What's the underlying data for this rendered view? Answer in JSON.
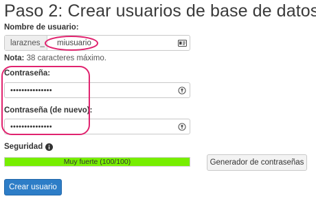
{
  "page": {
    "title": "Paso 2: Crear usuarios de base de datos:"
  },
  "username": {
    "label": "Nombre de usuario:",
    "prefix": "laraznes_",
    "value": "miusuario",
    "icon": "id-card-icon"
  },
  "note": {
    "label": "Nota:",
    "text": " 38 caracteres máximo."
  },
  "password": {
    "label": "Contraseña:",
    "value": "•••••••••••••••",
    "icon": "key-icon"
  },
  "password_confirm": {
    "label": "Contraseña (de nuevo):",
    "value": "•••••••••••••••",
    "icon": "key-icon"
  },
  "security": {
    "label": "Seguridad",
    "info_icon": "info-circle-icon",
    "strength_text": "Muy fuerte (100/100)",
    "strength_percent": 100,
    "strength_color": "#77ee00"
  },
  "buttons": {
    "generator": "Generador de contraseñas",
    "create": "Crear usuario"
  },
  "colors": {
    "annotation": "#e0226e",
    "primary": "#2d7dc7"
  }
}
